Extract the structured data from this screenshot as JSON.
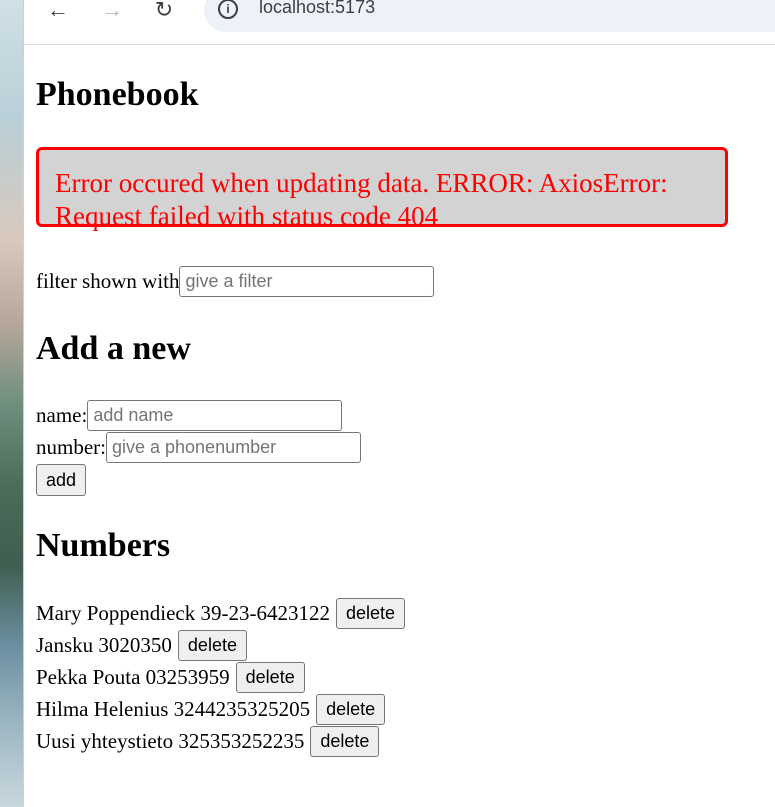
{
  "browser": {
    "url": "localhost:5173",
    "icons": {
      "back": "arrow-left-icon",
      "forward": "arrow-right-icon",
      "reload": "reload-icon",
      "site_info": "info-icon"
    }
  },
  "app": {
    "title": "Phonebook",
    "error_message": "Error occured when updating data. ERROR: AxiosError: Request failed with status code 404",
    "filter": {
      "label": "filter shown with",
      "placeholder": "give a filter",
      "value": ""
    },
    "add_form": {
      "heading": "Add a new",
      "name_label": "name:",
      "name_placeholder": "add name",
      "number_label": "number:",
      "number_placeholder": "give a phonenumber",
      "add_button": "add"
    },
    "numbers": {
      "heading": "Numbers",
      "delete_label": "delete",
      "persons": [
        {
          "text": "Mary Poppendieck 39-23-6423122"
        },
        {
          "text": "Jansku 3020350"
        },
        {
          "text": "Pekka Pouta 03253959"
        },
        {
          "text": "Hilma Helenius 3244235325205"
        },
        {
          "text": "Uusi yhteystieto 325353252235"
        }
      ]
    }
  },
  "colors": {
    "error_text": "#ff0000",
    "error_border": "#ff0000",
    "error_background": "#d3d3d3"
  }
}
